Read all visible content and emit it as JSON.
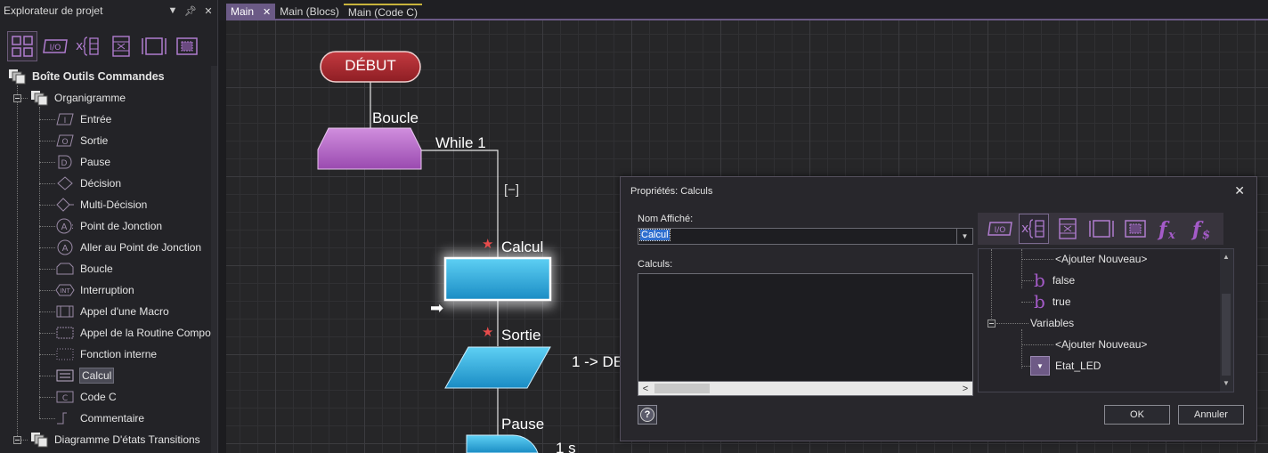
{
  "explorer": {
    "title": "Explorateur de projet",
    "toolbox": "Boîte Outils Commandes",
    "group_flowchart": "Organigramme",
    "items": [
      "Entrée",
      "Sortie",
      "Pause",
      "Décision",
      "Multi-Décision",
      "Point de Jonction",
      "Aller au Point de Jonction",
      "Boucle",
      "Interruption",
      "Appel d'une Macro",
      "Appel de la Routine Compo",
      "Fonction interne",
      "Calcul",
      "Code C",
      "Commentaire"
    ],
    "group_state": "Diagramme D'états Transitions",
    "selected_item": "Calcul"
  },
  "tabs": [
    {
      "label": "Main",
      "active": true,
      "closable": true
    },
    {
      "label": "Main (Blocs)",
      "active": false
    },
    {
      "label": "Main (Code C)",
      "active": false
    }
  ],
  "flowchart": {
    "start_label": "DÉBUT",
    "loop_label": "Boucle",
    "loop_condition": "While 1",
    "collapse_glyph": "[−]",
    "calc_label": "Calcul",
    "output_label": "Sortie",
    "output_expr": "1 -> DE",
    "pause_label": "Pause",
    "pause_value": "1 s",
    "star": "★",
    "arrow": "➡"
  },
  "dialog": {
    "title": "Propriétés: Calculs",
    "name_label": "Nom Affiché:",
    "name_value": "Calcul",
    "calc_label": "Calculs:",
    "close": "✕",
    "ok": "OK",
    "cancel": "Annuler",
    "help": "?"
  },
  "prop_tree": {
    "add_new_1": "<Ajouter Nouveau>",
    "false": "false",
    "true": "true",
    "variables": "Variables",
    "add_new_2": "<Ajouter Nouveau>",
    "etat_led": "Etat_LED"
  },
  "colors": {
    "accent": "#6b5a86",
    "start_fill": "#a8262e",
    "loop_fill": "#b86cc8",
    "flow_blue": "#2aa4d8",
    "glyph_purple": "#a45bc8"
  }
}
